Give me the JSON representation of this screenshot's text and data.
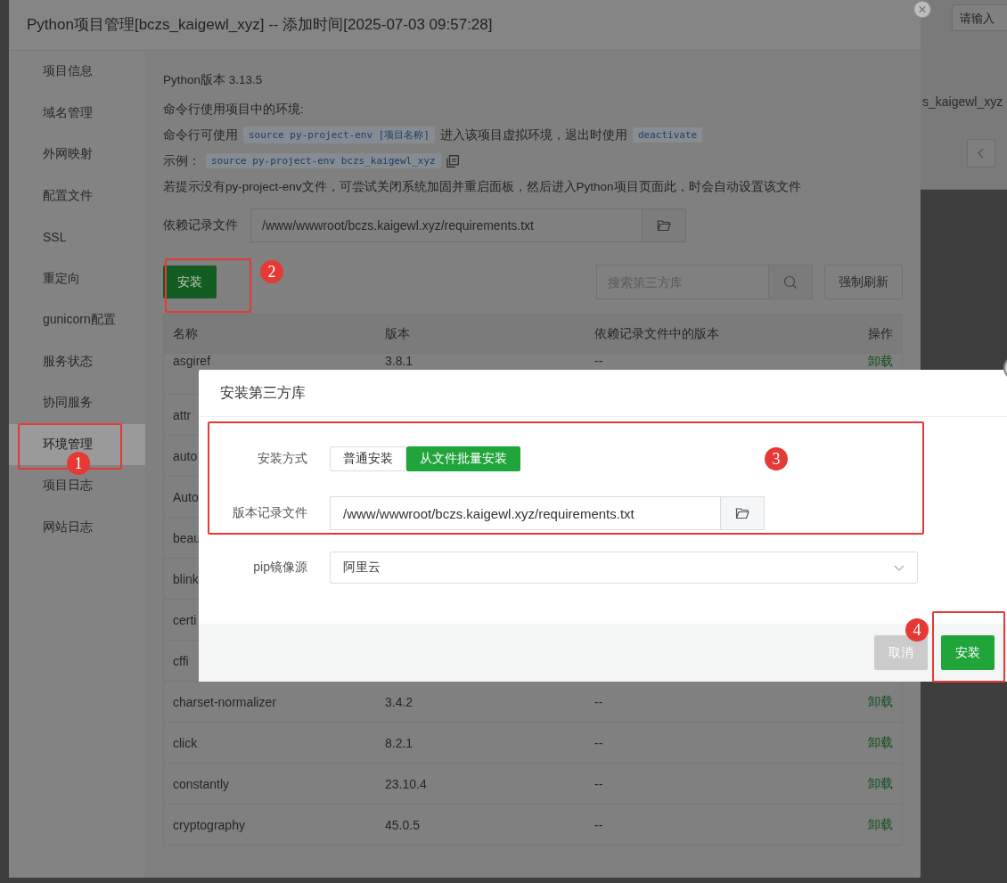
{
  "background_page": {
    "search_placeholder": "请输入",
    "project_text": "s_kaigewl_xyz"
  },
  "window": {
    "title": "Python项目管理[bczs_kaigewl_xyz] -- 添加时间[2025-07-03 09:57:28]"
  },
  "sidebar": {
    "items": [
      {
        "label": "项目信息",
        "selected": false
      },
      {
        "label": "域名管理",
        "selected": false
      },
      {
        "label": "外网映射",
        "selected": false
      },
      {
        "label": "配置文件",
        "selected": false
      },
      {
        "label": "SSL",
        "selected": false
      },
      {
        "label": "重定向",
        "selected": false
      },
      {
        "label": "gunicorn配置",
        "selected": false
      },
      {
        "label": "服务状态",
        "selected": false
      },
      {
        "label": "协同服务",
        "selected": false
      },
      {
        "label": "环境管理",
        "selected": true
      },
      {
        "label": "项目日志",
        "selected": false
      },
      {
        "label": "网站日志",
        "selected": false
      }
    ]
  },
  "env_info": {
    "python_version": "Python版本 3.13.5",
    "heading": "命令行使用项目中的环境:",
    "usage_prefix": "命令行可使用",
    "usage_command": "source py-project-env [项目名称]",
    "usage_middle": "进入该项目虚拟环境，退出时使用",
    "usage_deactivate": "deactivate",
    "example_label": "示例：",
    "example_command": "source py-project-env bczs_kaigewl_xyz",
    "note": "若提示没有py-project-env文件，可尝试关闭系统加固并重启面板，然后进入Python项目页面此，时会自动设置该文件"
  },
  "requirements_file": {
    "label": "依赖记录文件",
    "value": "/www/wwwroot/bczs.kaigewl.xyz/requirements.txt"
  },
  "toolbar": {
    "install_button": "安装",
    "search_placeholder": "搜索第三方库",
    "refresh_button": "强制刷新"
  },
  "table": {
    "columns": [
      "名称",
      "版本",
      "依赖记录文件中的版本",
      "操作"
    ],
    "rows": [
      {
        "name": "asgiref",
        "version": "3.8.1",
        "required": "--",
        "action": "卸载"
      },
      {
        "name": "attr"
      },
      {
        "name": "auto"
      },
      {
        "name": "Auto"
      },
      {
        "name": "beau"
      },
      {
        "name": "blink"
      },
      {
        "name": "certi"
      },
      {
        "name": "cffi"
      },
      {
        "name": "charset-normalizer",
        "version": "3.4.2",
        "required": "--",
        "action": "卸载"
      },
      {
        "name": "click",
        "version": "8.2.1",
        "required": "--",
        "action": "卸载"
      },
      {
        "name": "constantly",
        "version": "23.10.4",
        "required": "--",
        "action": "卸载"
      },
      {
        "name": "cryptography",
        "version": "45.0.5",
        "required": "--",
        "action": "卸载"
      }
    ]
  },
  "dialog": {
    "title": "安装第三方库",
    "install_mode": {
      "label": "安装方式",
      "options": [
        {
          "label": "普通安装",
          "selected": false
        },
        {
          "label": "从文件批量安装",
          "selected": true
        }
      ]
    },
    "version_file": {
      "label": "版本记录文件",
      "value": "/www/wwwroot/bczs.kaigewl.xyz/requirements.txt"
    },
    "mirror": {
      "label": "pip镜像源",
      "value": "阿里云"
    },
    "buttons": [
      {
        "label": "取消",
        "kind": "cancel"
      },
      {
        "label": "安装",
        "kind": "primary"
      }
    ]
  },
  "annotations": [
    {
      "label": "1"
    },
    {
      "label": "2"
    },
    {
      "label": "3"
    },
    {
      "label": "4"
    }
  ]
}
